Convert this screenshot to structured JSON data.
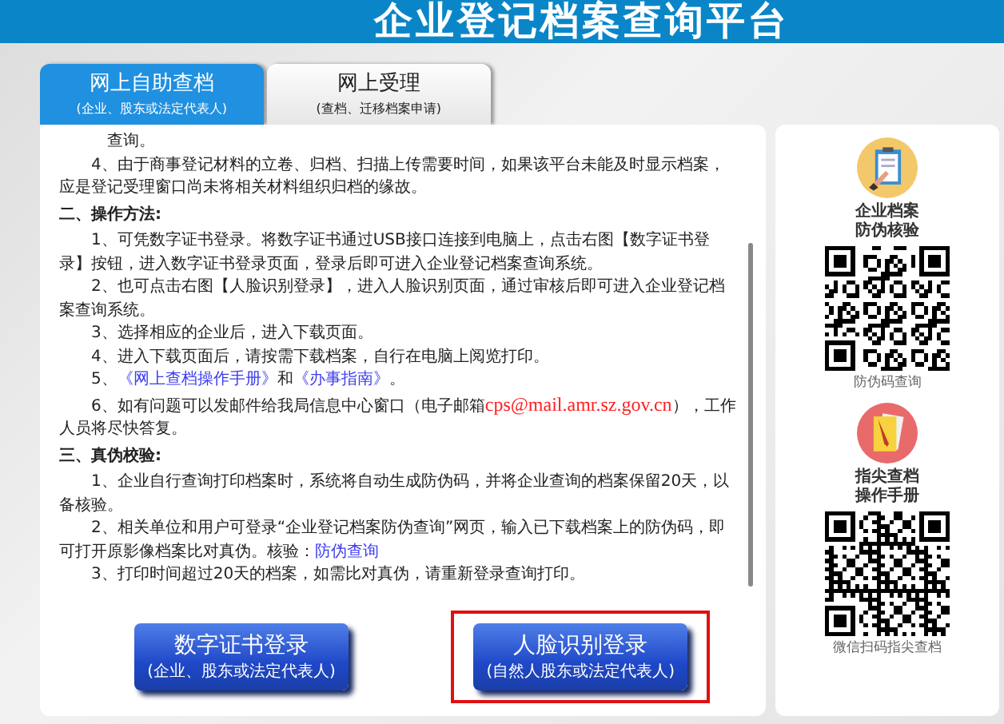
{
  "header": {
    "title": "企业登记档案查询平台"
  },
  "tabs": [
    {
      "title": "网上自助查档",
      "subtitle": "(企业、股东或法定代表人)",
      "selected": true
    },
    {
      "title": "网上受理",
      "subtitle": "(查档、迁移档案申请)",
      "selected": false
    }
  ],
  "content": [
    {
      "kind": "continuation",
      "parts": [
        {
          "kind": "text",
          "text": "查询。"
        }
      ]
    },
    {
      "kind": "item",
      "parts": [
        {
          "kind": "text",
          "text": "4、由于商事登记材料的立卷、归档、扫描上传需要时间，如果该平台未能及时显示档案，应是登记受理窗口尚未将相关材料组织归档的缘故。"
        }
      ]
    },
    {
      "kind": "heading",
      "text": "二、操作方法:"
    },
    {
      "kind": "item",
      "parts": [
        {
          "kind": "text",
          "text": "1、可凭数字证书登录。将数字证书通过USB接口连接到电脑上，点击右图【数字证书登录】按钮，进入数字证书登录页面，登录后即可进入企业登记档案查询系统。"
        }
      ]
    },
    {
      "kind": "item",
      "parts": [
        {
          "kind": "text",
          "text": "2、也可点击右图【人脸识别登录】，进入人脸识别页面，通过审核后即可进入企业登记档案查询系统。"
        }
      ]
    },
    {
      "kind": "item",
      "parts": [
        {
          "kind": "text",
          "text": "3、选择相应的企业后，进入下载页面。"
        }
      ]
    },
    {
      "kind": "item",
      "parts": [
        {
          "kind": "text",
          "text": "4、进入下载页面后，请按需下载档案，自行在电脑上阅览打印。"
        }
      ]
    },
    {
      "kind": "item",
      "parts": [
        {
          "kind": "text",
          "text": "5、"
        },
        {
          "kind": "link",
          "text": "《网上查档操作手册》"
        },
        {
          "kind": "text",
          "text": "和"
        },
        {
          "kind": "link",
          "text": "《办事指南》"
        },
        {
          "kind": "text",
          "text": "。"
        }
      ]
    },
    {
      "kind": "item",
      "parts": [
        {
          "kind": "text",
          "text": "6、如有问题可以发邮件给我局信息中心窗口（电子邮箱"
        },
        {
          "kind": "email",
          "text": "cps@mail.amr.sz.gov.cn"
        },
        {
          "kind": "text",
          "text": "），工作人员将尽快答复。"
        }
      ]
    },
    {
      "kind": "heading",
      "text": "三、真伪校验:"
    },
    {
      "kind": "item",
      "parts": [
        {
          "kind": "text",
          "text": "1、企业自行查询打印档案时，系统将自动生成防伪码，并将企业查询的档案保留20天，以备核验。"
        }
      ]
    },
    {
      "kind": "item",
      "parts": [
        {
          "kind": "text",
          "text": "2、相关单位和用户可登录“企业登记档案防伪查询”网页，输入已下载档案上的防伪码，即可打开原影像档案比对真伪。核验："
        },
        {
          "kind": "link",
          "text": "防伪查询"
        }
      ]
    },
    {
      "kind": "item",
      "parts": [
        {
          "kind": "text",
          "text": "3、打印时间超过20天的档案，如需比对真伪，请重新登录查询打印。"
        }
      ]
    }
  ],
  "buttons": [
    {
      "title": "数字证书登录",
      "subtitle": "(企业、股东或法定代表人)",
      "highlighted": false
    },
    {
      "title": "人脸识别登录",
      "subtitle": "(自然人股东或法定代表人)",
      "highlighted": true
    }
  ],
  "side_cards": [
    {
      "kind": "clipboard",
      "title_lines": [
        "企业档案",
        "防伪核验"
      ],
      "caption": "防伪码查询"
    },
    {
      "kind": "notebook",
      "title_lines": [
        "指尖查档",
        "操作手册"
      ],
      "caption": "微信扫码指尖查档"
    }
  ]
}
